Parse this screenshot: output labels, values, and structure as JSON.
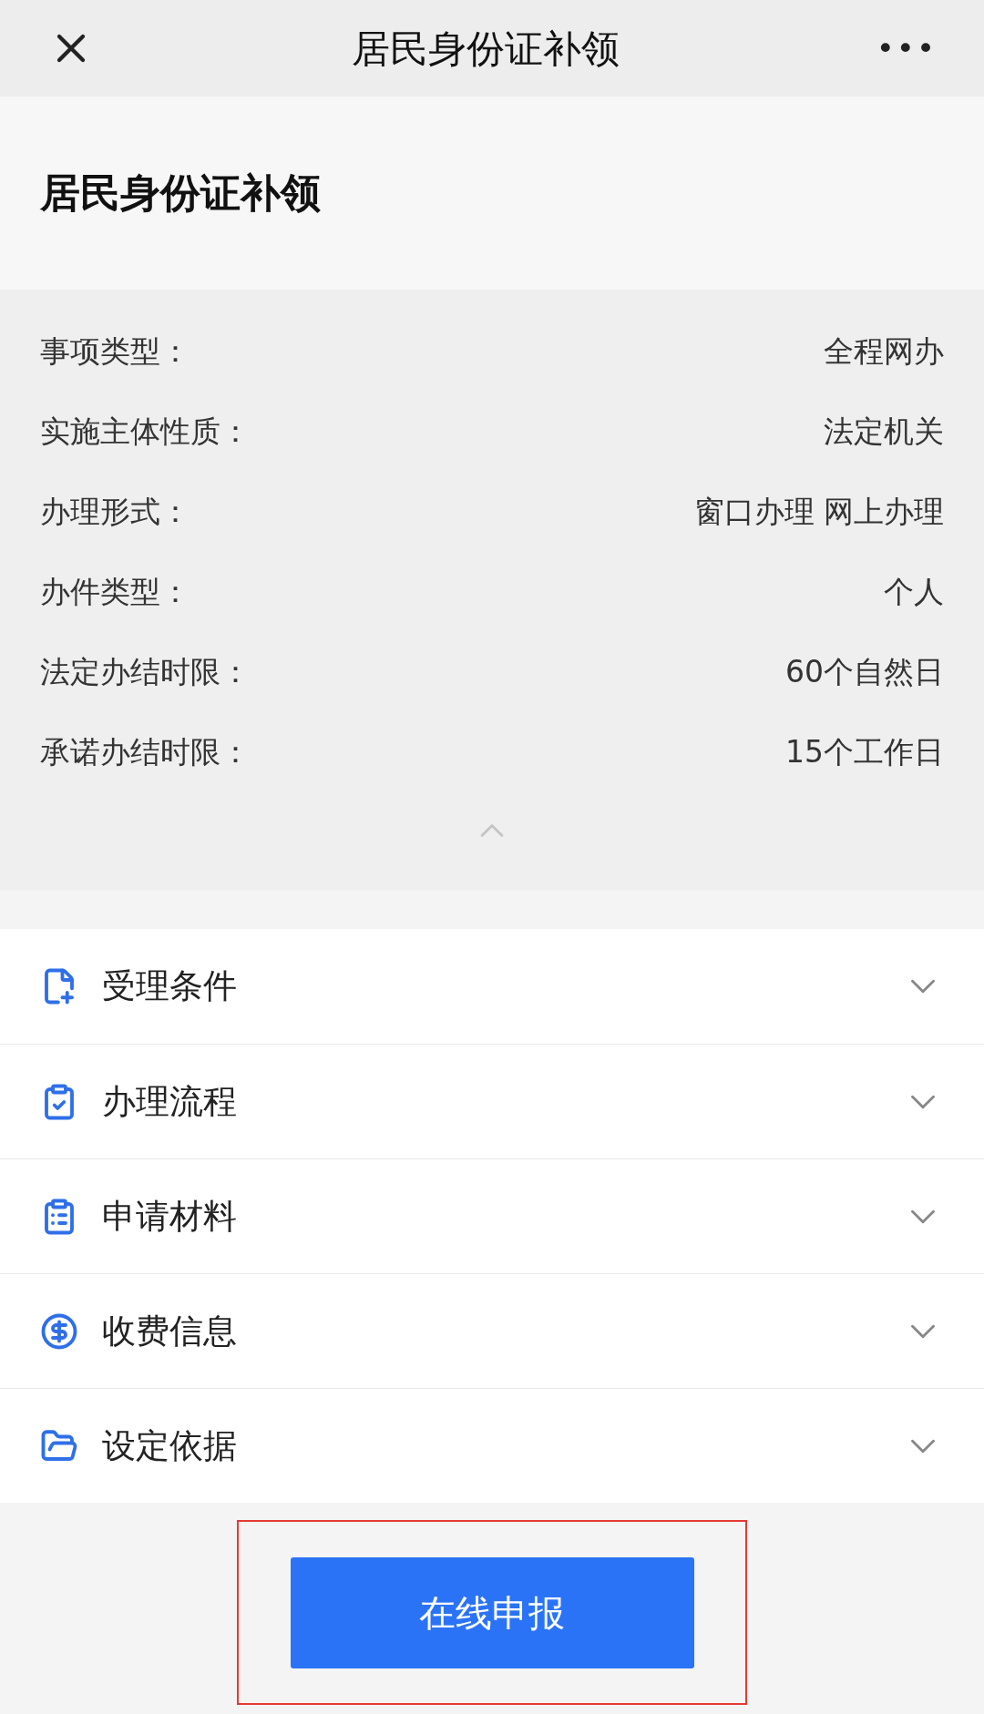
{
  "header": {
    "title": "居民身份证补领",
    "more": "•••"
  },
  "service_title": "居民身份证补领",
  "info": {
    "expanded": true,
    "rows": [
      {
        "label": "事项类型：",
        "value": "全程网办"
      },
      {
        "label": "实施主体性质：",
        "value": "法定机关"
      },
      {
        "label": "办理形式：",
        "value": "窗口办理 网上办理"
      },
      {
        "label": "办件类型：",
        "value": "个人"
      },
      {
        "label": "法定办结时限：",
        "value": "60个自然日"
      },
      {
        "label": "承诺办结时限：",
        "value": "15个工作日"
      }
    ]
  },
  "sections": [
    {
      "kind": "conditions",
      "label": "受理条件",
      "expanded": false
    },
    {
      "kind": "process",
      "label": "办理流程",
      "expanded": false
    },
    {
      "kind": "materials",
      "label": "申请材料",
      "expanded": false
    },
    {
      "kind": "fees",
      "label": "收费信息",
      "expanded": false
    },
    {
      "kind": "basis",
      "label": "设定依据",
      "expanded": false
    }
  ],
  "submit_button": {
    "label": "在线申报",
    "highlighted": true
  }
}
